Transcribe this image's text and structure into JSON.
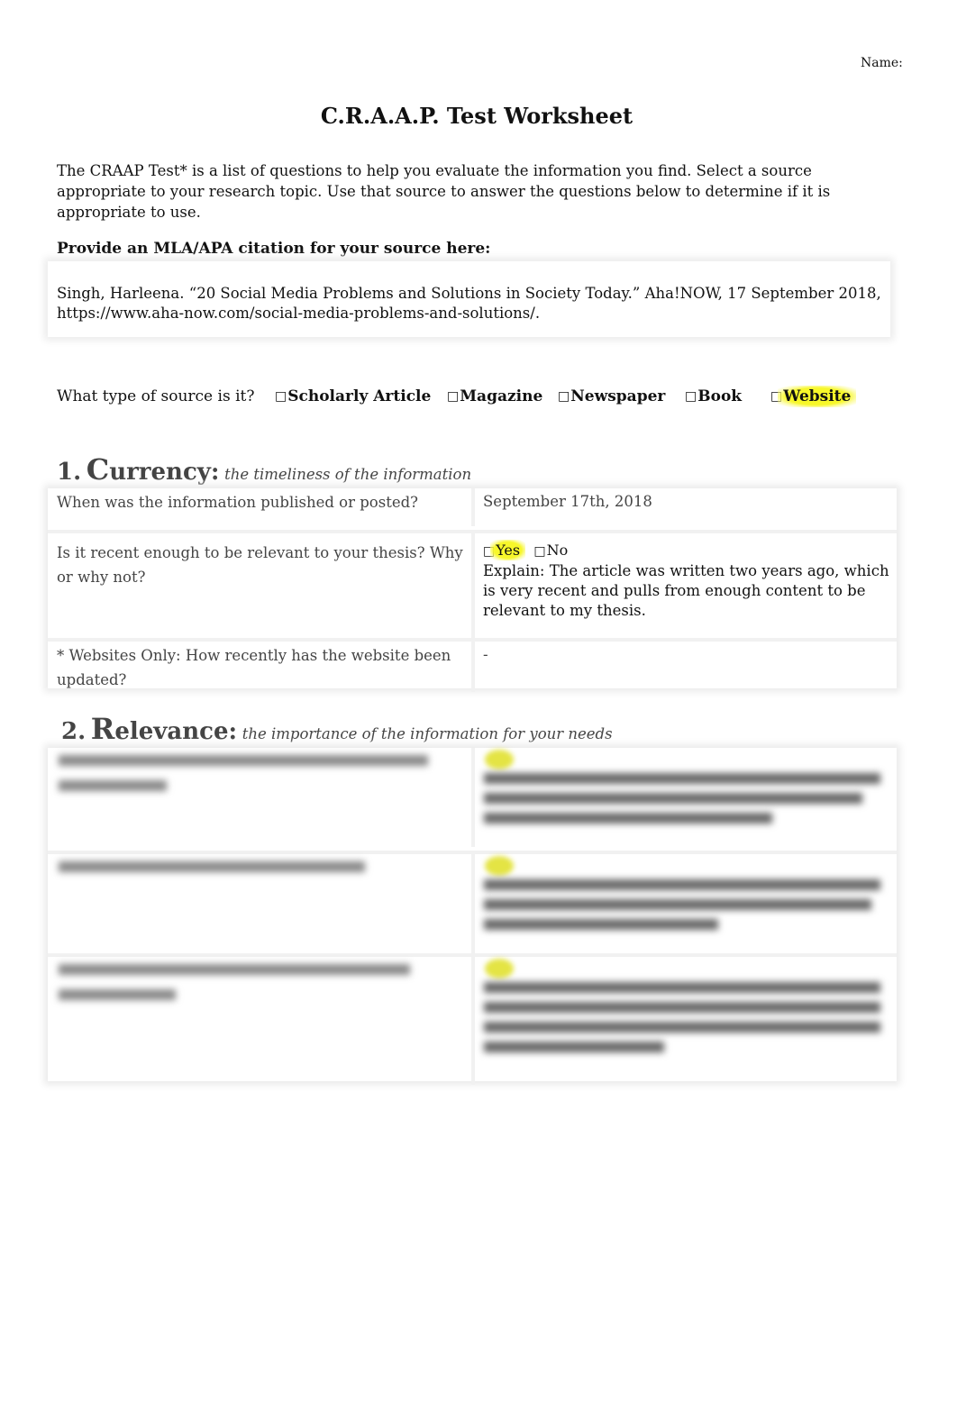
{
  "header": {
    "name_label": "Name:",
    "title": "C.R.A.A.P. Test Worksheet",
    "intro": "The CRAAP Test* is a list of questions to help you evaluate the information you find. Select a source appropriate to your research topic.  Use that source to answer the questions below to determine if it is appropriate to use."
  },
  "citation": {
    "label": "Provide an MLA/APA citation for your source here:",
    "text": "Singh, Harleena. “20 Social Media Problems and Solutions in Society Today.” Aha!NOW, 17 September 2018, https://www.aha-now.com/social-media-problems-and-solutions/."
  },
  "source_type": {
    "question": "What type of source is it?",
    "checkbox_glyph": "□",
    "options": [
      {
        "label": "Scholarly Article",
        "highlighted": false
      },
      {
        "label": "Magazine",
        "highlighted": false
      },
      {
        "label": "Newspaper",
        "highlighted": false
      },
      {
        "label": "Book",
        "highlighted": false
      },
      {
        "label": "Website",
        "highlighted": true
      }
    ],
    "highlight_color": "#f7f72a"
  },
  "sections": [
    {
      "number": "1.",
      "initial": "C",
      "rest": "urrency:",
      "subtitle": "the timeliness of the information",
      "rows": [
        {
          "question": "When was the information published or posted?",
          "answer": "September 17th, 2018"
        },
        {
          "question": "Is it recent enough to be relevant to your thesis? Why or why not?",
          "yes_label": "Yes",
          "no_label": "No",
          "selected": "Yes",
          "answer": "Explain: The article was written two years ago, which is very recent and pulls from enough content to be relevant to my thesis."
        },
        {
          "question": "* Websites Only: How recently has the website been updated?",
          "answer": "-"
        }
      ]
    },
    {
      "number": "2.",
      "initial": "R",
      "rest": "elevance:",
      "subtitle": "the importance of the information for your needs",
      "blurred": true
    }
  ]
}
